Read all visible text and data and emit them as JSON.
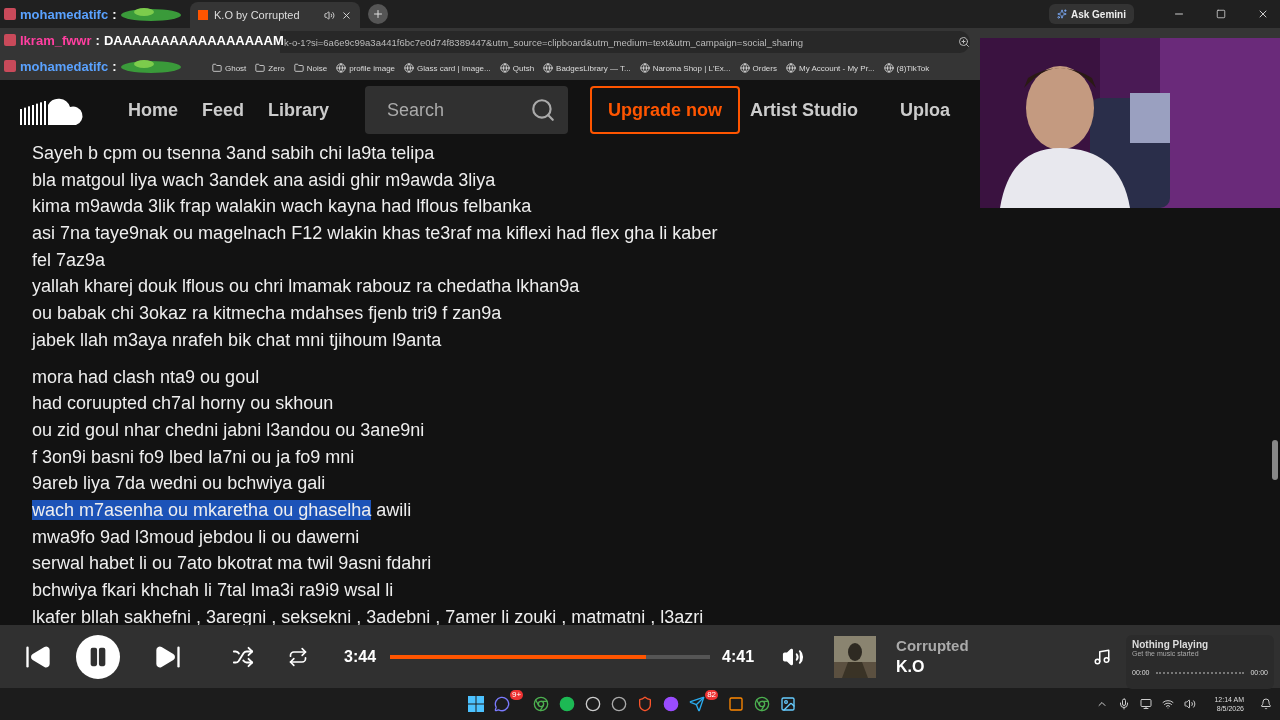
{
  "browser": {
    "tabs": [
      {
        "title": "K.O by Corrupted",
        "selected": true,
        "audio": true
      }
    ],
    "ask_button": "Ask Gemini",
    "address": "k-o-1?si=6a6e9c99a3a441f6bc7e0d74f8389447&utm_source=clipboard&utm_medium=text&utm_campaign=social_sharing",
    "bookmarks": [
      "Ghost",
      "Zero",
      "Noise",
      "profile image",
      "Glass card | Image...",
      "Qutsh",
      "BadgesLibrary — T...",
      "Naroma Shop | L'Ex...",
      "Orders",
      "My Account - My Pr...",
      "(8)TikTok"
    ]
  },
  "chat": [
    {
      "user": "mohamedatifc",
      "color": "#5aa2ff",
      "separator": ":",
      "emote": true
    },
    {
      "user": "Ikram_fwwr",
      "color": "#ff3fa0",
      "separator": ":",
      "message": "DAAAAAAAAAAAAAAAAAM"
    },
    {
      "user": "mohamedatifc",
      "color": "#5aa2ff",
      "separator": ":",
      "emote": true
    }
  ],
  "site": {
    "nav": [
      {
        "label": "Home"
      },
      {
        "label": "Feed"
      },
      {
        "label": "Library"
      }
    ],
    "search": {
      "placeholder": "Search"
    },
    "upgrade": "Upgrade now",
    "nav_right": [
      "Artist Studio",
      "Uploa"
    ]
  },
  "lyrics": [
    [
      {
        "segments": [
          {
            "text": "Sayeh b cpm ou tsenna 3and sabih chi la9ta telipa",
            "selected": false
          }
        ]
      },
      {
        "segments": [
          {
            "text": "bla matgoul liya wach 3andek ana asidi ghir m9awda 3liya",
            "selected": false
          }
        ]
      },
      {
        "segments": [
          {
            "text": "kima m9awda 3lik frap walakin wach kayna had lflous felbanka",
            "selected": false
          }
        ]
      },
      {
        "segments": [
          {
            "text": "asi 7na taye9nak ou magelnach F12 wlakin khas te3raf ma kiflexi had flex gha li kaber",
            "selected": false
          }
        ]
      },
      {
        "segments": [
          {
            "text": "fel 7az9a",
            "selected": false
          }
        ]
      },
      {
        "segments": [
          {
            "text": "yallah kharej douk lflous ou chri lmamak rabouz ra chedatha lkhan9a",
            "selected": false
          }
        ]
      },
      {
        "segments": [
          {
            "text": "ou babak chi 3okaz ra kitmecha mdahses fjenb tri9 f zan9a",
            "selected": false
          }
        ]
      },
      {
        "segments": [
          {
            "text": "jabek llah m3aya nrafeh bik chat mni tjihoum l9anta",
            "selected": false
          }
        ]
      }
    ],
    [
      {
        "segments": [
          {
            "text": "mora had clash nta9 ou goul",
            "selected": false
          }
        ]
      },
      {
        "segments": [
          {
            "text": "had coruupted ch7al horny ou skhoun",
            "selected": false
          }
        ]
      },
      {
        "segments": [
          {
            "text": "ou zid goul nhar chedni jabni l3andou ou 3ane9ni",
            "selected": false
          }
        ]
      },
      {
        "segments": [
          {
            "text": "f 3on9i basni fo9 lbed la7ni ou ja fo9 mni",
            "selected": false
          }
        ]
      },
      {
        "segments": [
          {
            "text": "9areb liya 7da wedni ou bchwiya gali",
            "selected": false
          }
        ]
      },
      {
        "segments": [
          {
            "text": "wach m7asenha ou mkaretha ou ghaselha",
            "selected": true
          },
          {
            "text": " awili",
            "selected": false
          }
        ]
      },
      {
        "segments": [
          {
            "text": "mwa9fo 9ad l3moud jebdou li ou dawerni",
            "selected": false
          }
        ]
      },
      {
        "segments": [
          {
            "text": "serwal habet li ou 7ato bkotrat ma twil 9asni fdahri",
            "selected": false
          }
        ]
      },
      {
        "segments": [
          {
            "text": "bchwiya fkari khchah li 7tal lma3i ra9i9 wsal li",
            "selected": false
          }
        ]
      },
      {
        "segments": [
          {
            "text": "lkafer bllah sakhefni , 3aregni , seksekni , 3adebni , 7amer li zouki , matmatni , l3azri",
            "selected": false
          }
        ]
      }
    ]
  ],
  "player": {
    "playing": true,
    "elapsed": "3:44",
    "duration": "4:41",
    "level": 0.8,
    "artist": "Corrupted",
    "track": "K.O"
  },
  "widget": {
    "title": "Nothing Playing",
    "subtitle": "Get the music started",
    "start": "00:00",
    "end": "00:00"
  },
  "taskbar": {
    "badges": [
      "9+",
      "82"
    ],
    "time": "12:14 AM",
    "date": "8/5/2026"
  }
}
